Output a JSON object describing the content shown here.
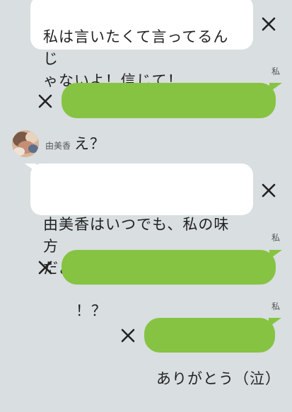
{
  "colors": {
    "background": "#d9dee0",
    "incoming_bubble": "#ffffff",
    "outgoing_bubble": "#86c343",
    "text": "#222222"
  },
  "messages": [
    {
      "direction": "incoming",
      "sender": "",
      "text": "私は言いたくて言ってるんじ\nゃないよ！信じて！",
      "action_icon": "close-icon"
    },
    {
      "direction": "outgoing",
      "sender": "私",
      "text": "え？",
      "action_icon": "close-icon"
    },
    {
      "direction": "incoming",
      "sender": "由美香",
      "text": "由美香はいつでも、私の味方\nだよ！",
      "action_icon": "close-icon"
    },
    {
      "direction": "outgoing",
      "sender": "私",
      "text": "！？",
      "action_icon": "close-icon"
    },
    {
      "direction": "outgoing",
      "sender": "私",
      "text": "ありがとう（泣）",
      "action_icon": "close-icon"
    }
  ]
}
